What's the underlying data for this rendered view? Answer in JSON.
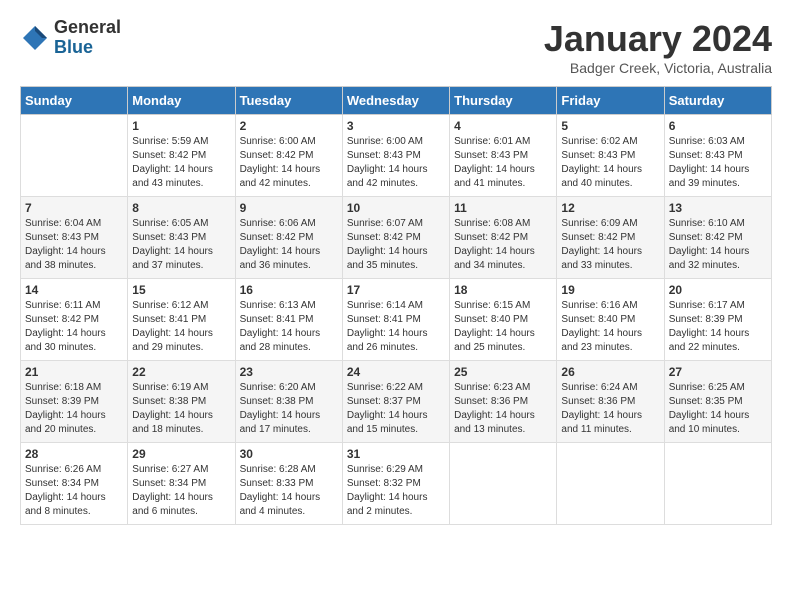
{
  "logo": {
    "general": "General",
    "blue": "Blue"
  },
  "title": "January 2024",
  "location": "Badger Creek, Victoria, Australia",
  "days_header": [
    "Sunday",
    "Monday",
    "Tuesday",
    "Wednesday",
    "Thursday",
    "Friday",
    "Saturday"
  ],
  "weeks": [
    [
      {
        "day": "",
        "sunrise": "",
        "sunset": "",
        "daylight": ""
      },
      {
        "day": "1",
        "sunrise": "Sunrise: 5:59 AM",
        "sunset": "Sunset: 8:42 PM",
        "daylight": "Daylight: 14 hours and 43 minutes."
      },
      {
        "day": "2",
        "sunrise": "Sunrise: 6:00 AM",
        "sunset": "Sunset: 8:42 PM",
        "daylight": "Daylight: 14 hours and 42 minutes."
      },
      {
        "day": "3",
        "sunrise": "Sunrise: 6:00 AM",
        "sunset": "Sunset: 8:43 PM",
        "daylight": "Daylight: 14 hours and 42 minutes."
      },
      {
        "day": "4",
        "sunrise": "Sunrise: 6:01 AM",
        "sunset": "Sunset: 8:43 PM",
        "daylight": "Daylight: 14 hours and 41 minutes."
      },
      {
        "day": "5",
        "sunrise": "Sunrise: 6:02 AM",
        "sunset": "Sunset: 8:43 PM",
        "daylight": "Daylight: 14 hours and 40 minutes."
      },
      {
        "day": "6",
        "sunrise": "Sunrise: 6:03 AM",
        "sunset": "Sunset: 8:43 PM",
        "daylight": "Daylight: 14 hours and 39 minutes."
      }
    ],
    [
      {
        "day": "7",
        "sunrise": "Sunrise: 6:04 AM",
        "sunset": "Sunset: 8:43 PM",
        "daylight": "Daylight: 14 hours and 38 minutes."
      },
      {
        "day": "8",
        "sunrise": "Sunrise: 6:05 AM",
        "sunset": "Sunset: 8:43 PM",
        "daylight": "Daylight: 14 hours and 37 minutes."
      },
      {
        "day": "9",
        "sunrise": "Sunrise: 6:06 AM",
        "sunset": "Sunset: 8:42 PM",
        "daylight": "Daylight: 14 hours and 36 minutes."
      },
      {
        "day": "10",
        "sunrise": "Sunrise: 6:07 AM",
        "sunset": "Sunset: 8:42 PM",
        "daylight": "Daylight: 14 hours and 35 minutes."
      },
      {
        "day": "11",
        "sunrise": "Sunrise: 6:08 AM",
        "sunset": "Sunset: 8:42 PM",
        "daylight": "Daylight: 14 hours and 34 minutes."
      },
      {
        "day": "12",
        "sunrise": "Sunrise: 6:09 AM",
        "sunset": "Sunset: 8:42 PM",
        "daylight": "Daylight: 14 hours and 33 minutes."
      },
      {
        "day": "13",
        "sunrise": "Sunrise: 6:10 AM",
        "sunset": "Sunset: 8:42 PM",
        "daylight": "Daylight: 14 hours and 32 minutes."
      }
    ],
    [
      {
        "day": "14",
        "sunrise": "Sunrise: 6:11 AM",
        "sunset": "Sunset: 8:42 PM",
        "daylight": "Daylight: 14 hours and 30 minutes."
      },
      {
        "day": "15",
        "sunrise": "Sunrise: 6:12 AM",
        "sunset": "Sunset: 8:41 PM",
        "daylight": "Daylight: 14 hours and 29 minutes."
      },
      {
        "day": "16",
        "sunrise": "Sunrise: 6:13 AM",
        "sunset": "Sunset: 8:41 PM",
        "daylight": "Daylight: 14 hours and 28 minutes."
      },
      {
        "day": "17",
        "sunrise": "Sunrise: 6:14 AM",
        "sunset": "Sunset: 8:41 PM",
        "daylight": "Daylight: 14 hours and 26 minutes."
      },
      {
        "day": "18",
        "sunrise": "Sunrise: 6:15 AM",
        "sunset": "Sunset: 8:40 PM",
        "daylight": "Daylight: 14 hours and 25 minutes."
      },
      {
        "day": "19",
        "sunrise": "Sunrise: 6:16 AM",
        "sunset": "Sunset: 8:40 PM",
        "daylight": "Daylight: 14 hours and 23 minutes."
      },
      {
        "day": "20",
        "sunrise": "Sunrise: 6:17 AM",
        "sunset": "Sunset: 8:39 PM",
        "daylight": "Daylight: 14 hours and 22 minutes."
      }
    ],
    [
      {
        "day": "21",
        "sunrise": "Sunrise: 6:18 AM",
        "sunset": "Sunset: 8:39 PM",
        "daylight": "Daylight: 14 hours and 20 minutes."
      },
      {
        "day": "22",
        "sunrise": "Sunrise: 6:19 AM",
        "sunset": "Sunset: 8:38 PM",
        "daylight": "Daylight: 14 hours and 18 minutes."
      },
      {
        "day": "23",
        "sunrise": "Sunrise: 6:20 AM",
        "sunset": "Sunset: 8:38 PM",
        "daylight": "Daylight: 14 hours and 17 minutes."
      },
      {
        "day": "24",
        "sunrise": "Sunrise: 6:22 AM",
        "sunset": "Sunset: 8:37 PM",
        "daylight": "Daylight: 14 hours and 15 minutes."
      },
      {
        "day": "25",
        "sunrise": "Sunrise: 6:23 AM",
        "sunset": "Sunset: 8:36 PM",
        "daylight": "Daylight: 14 hours and 13 minutes."
      },
      {
        "day": "26",
        "sunrise": "Sunrise: 6:24 AM",
        "sunset": "Sunset: 8:36 PM",
        "daylight": "Daylight: 14 hours and 11 minutes."
      },
      {
        "day": "27",
        "sunrise": "Sunrise: 6:25 AM",
        "sunset": "Sunset: 8:35 PM",
        "daylight": "Daylight: 14 hours and 10 minutes."
      }
    ],
    [
      {
        "day": "28",
        "sunrise": "Sunrise: 6:26 AM",
        "sunset": "Sunset: 8:34 PM",
        "daylight": "Daylight: 14 hours and 8 minutes."
      },
      {
        "day": "29",
        "sunrise": "Sunrise: 6:27 AM",
        "sunset": "Sunset: 8:34 PM",
        "daylight": "Daylight: 14 hours and 6 minutes."
      },
      {
        "day": "30",
        "sunrise": "Sunrise: 6:28 AM",
        "sunset": "Sunset: 8:33 PM",
        "daylight": "Daylight: 14 hours and 4 minutes."
      },
      {
        "day": "31",
        "sunrise": "Sunrise: 6:29 AM",
        "sunset": "Sunset: 8:32 PM",
        "daylight": "Daylight: 14 hours and 2 minutes."
      },
      {
        "day": "",
        "sunrise": "",
        "sunset": "",
        "daylight": ""
      },
      {
        "day": "",
        "sunrise": "",
        "sunset": "",
        "daylight": ""
      },
      {
        "day": "",
        "sunrise": "",
        "sunset": "",
        "daylight": ""
      }
    ]
  ]
}
